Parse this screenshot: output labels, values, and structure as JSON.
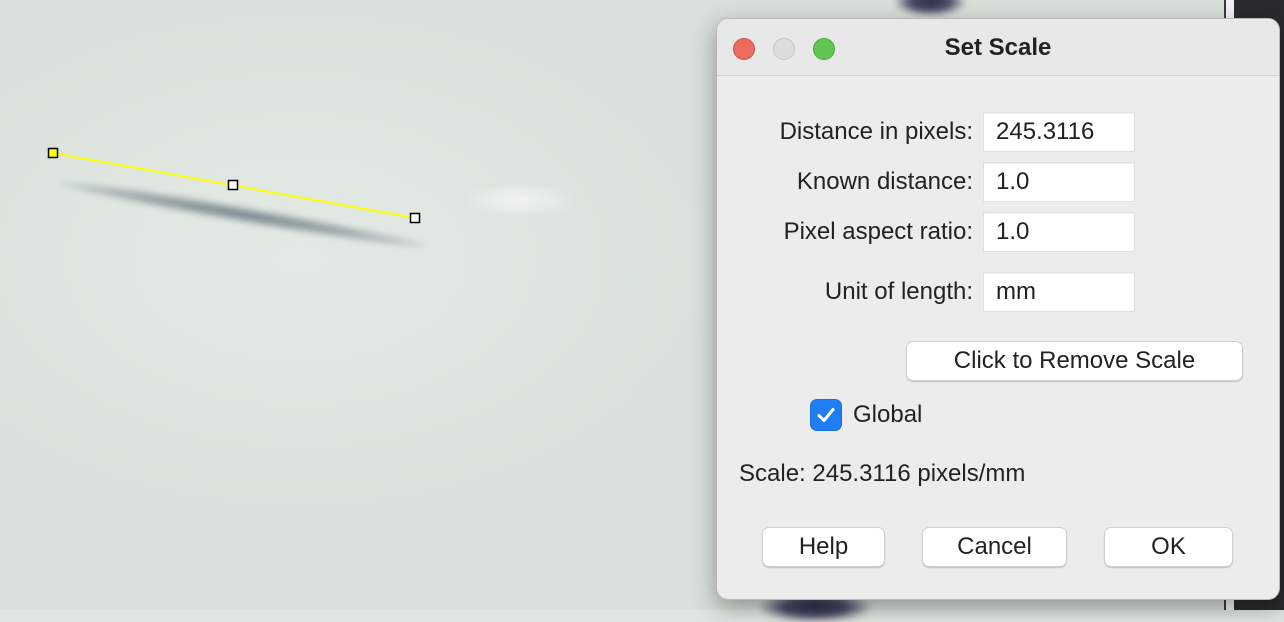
{
  "dialog": {
    "title": "Set Scale",
    "fields": [
      {
        "label": "Distance in pixels:",
        "value": "245.3116"
      },
      {
        "label": "Known distance:",
        "value": "1.0"
      },
      {
        "label": "Pixel aspect ratio:",
        "value": "1.0"
      },
      {
        "label": "Unit of length:",
        "value": "mm"
      }
    ],
    "remove_scale_label": "Click to Remove Scale",
    "global": {
      "label": "Global",
      "checked": true
    },
    "scale_text": "Scale: 245.3116 pixels/mm",
    "buttons": {
      "help": "Help",
      "cancel": "Cancel",
      "ok": "OK"
    }
  },
  "colors": {
    "line_selection": "#ffff00",
    "checkbox_accent": "#1f7ef5",
    "close": "#ed6a5e",
    "zoom": "#61c554"
  }
}
